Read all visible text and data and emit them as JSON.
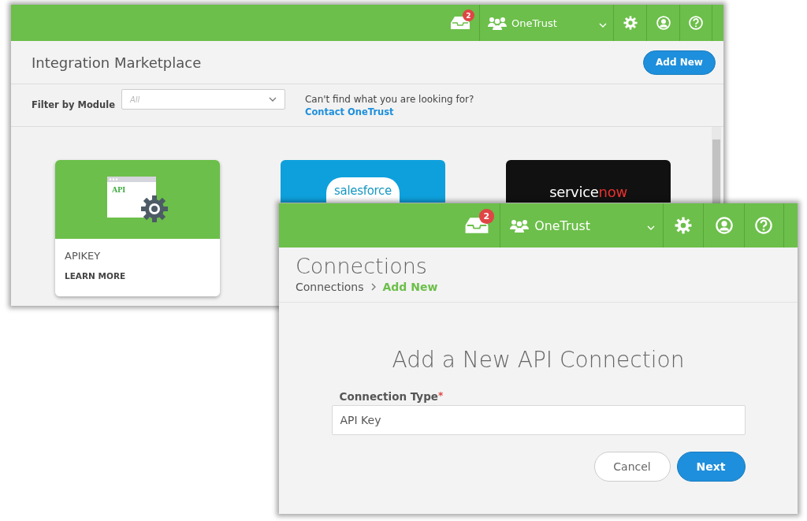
{
  "marketplace_window": {
    "topbar": {
      "notification_count": "2",
      "org_name": "OneTrust"
    },
    "title": "Integration Marketplace",
    "add_button": "Add New",
    "filter": {
      "label": "Filter by Module",
      "placeholder": "All"
    },
    "help_text": "Can't find what you are looking for?",
    "help_link": "Contact OneTrust",
    "cards": [
      {
        "kind": "api",
        "icon_text": "API",
        "name": "APIKEY",
        "link": "LEARN MORE"
      },
      {
        "kind": "salesforce",
        "logo": [
          {
            "text": "salesforce",
            "color": "#1798c1"
          }
        ]
      },
      {
        "kind": "servicenow",
        "logo": [
          {
            "text": "service",
            "color": "#ffffff"
          },
          {
            "text": "now",
            "color": "#e8312f"
          }
        ]
      }
    ]
  },
  "connection_window": {
    "topbar": {
      "notification_count": "2",
      "org_name": "OneTrust"
    },
    "title": "Connections",
    "breadcrumb": [
      {
        "label": "Connections",
        "selected": false
      },
      {
        "label": "Add New",
        "selected": true
      }
    ],
    "heading": "Add a New API Connection",
    "field": {
      "label": "Connection Type",
      "required_mark": "*",
      "value": "API Key"
    },
    "buttons": [
      {
        "kind": "secondary",
        "label": "Cancel"
      },
      {
        "kind": "primary",
        "label": "Next"
      }
    ]
  }
}
